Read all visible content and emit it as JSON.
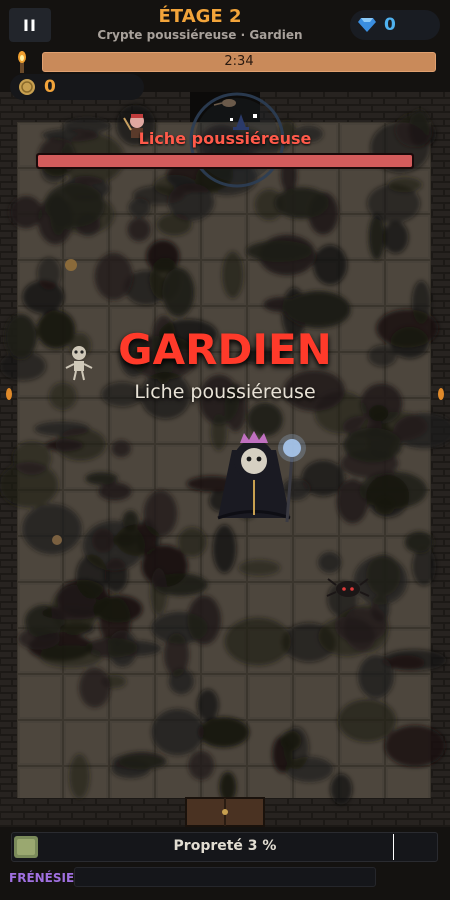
{
  "hud": {
    "pause_label": "II",
    "stage_title": "ÉTAGE 2",
    "stage_subtitle": "Crypte poussiéreuse · Gardien",
    "gems": "0",
    "timer": "2:34",
    "timer_fraction": 1.0,
    "coins": "0"
  },
  "boss": {
    "name": "Liche poussiéreuse",
    "health_fraction": 1.0,
    "banner_title": "GARDIEN",
    "banner_subtitle": "Liche poussiéreuse"
  },
  "footer": {
    "cleanliness_label": "Propreté 3 %",
    "cleanliness_fraction": 0.03,
    "frenzy_label": "FRÉNÉSIE",
    "frenzy_fraction": 0
  },
  "icons": {
    "pause": "pause-icon",
    "gem": "diamond-icon",
    "torch": "torch-icon",
    "coin": "coin-icon",
    "broom": "cleanliness-icon"
  },
  "colors": {
    "stage_title": "#f2a43a",
    "gem_count": "#4fb2f0",
    "coin_count": "#f2a43a",
    "boss_name": "#ff5a4a",
    "banner": "#ff3a2a",
    "boss_health": "#d45c5c",
    "timer_bar": "#c98a5a",
    "frenzy": "#a070e0"
  }
}
